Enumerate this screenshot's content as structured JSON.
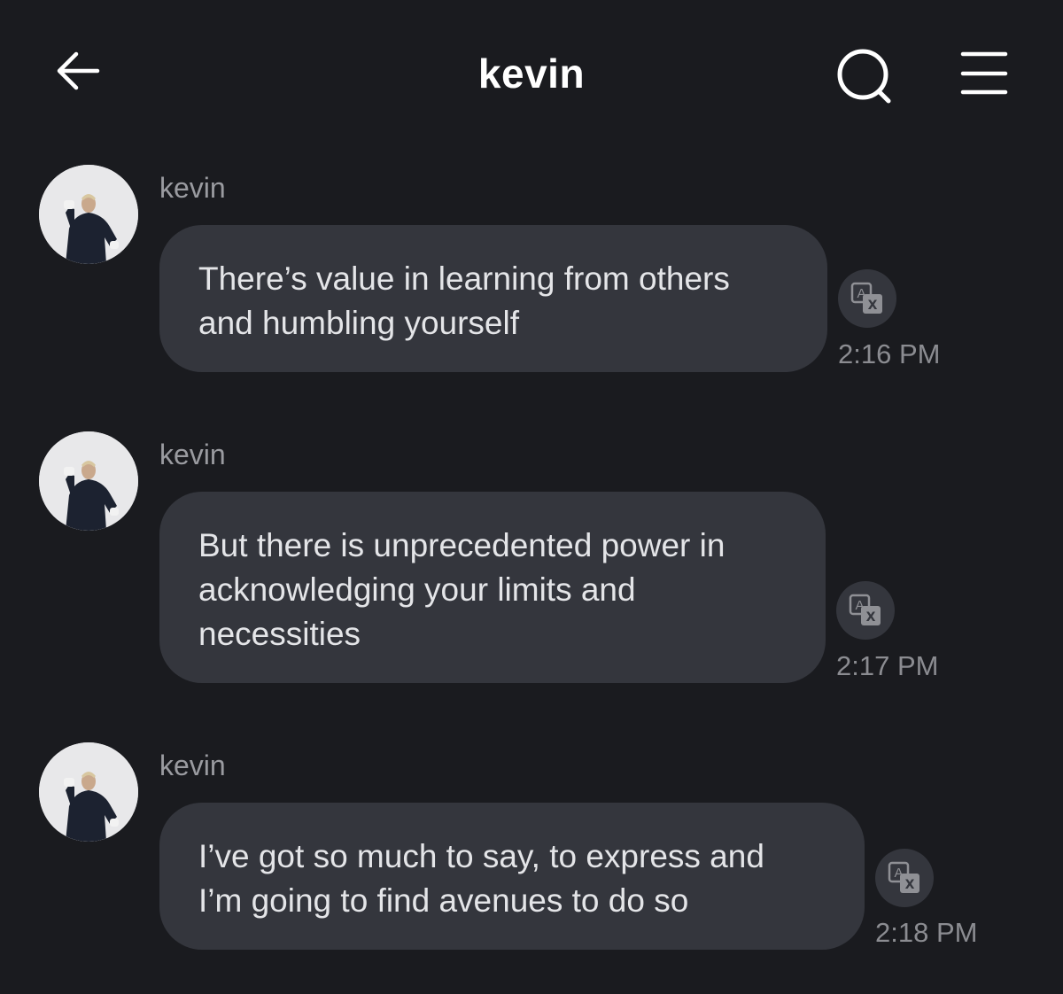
{
  "header": {
    "title": "kevin"
  },
  "icons": {
    "back": "back-arrow-icon",
    "search": "search-icon",
    "menu": "menu-icon",
    "translate": "translate-icon"
  },
  "colors": {
    "background": "#1a1b1f",
    "bubble": "#34363d",
    "text": "#e4e5e8",
    "secondary_text": "#8b8c91"
  },
  "messages": [
    {
      "sender": "kevin",
      "lines": [
        "There’s value in learning from others",
        "and humbling yourself"
      ],
      "time": "2:16 PM"
    },
    {
      "sender": "kevin",
      "lines": [
        "But there is unprecedented power in",
        "acknowledging your limits and",
        "necessities"
      ],
      "time": "2:17 PM"
    },
    {
      "sender": "kevin",
      "lines": [
        "I’ve got so much to say, to express and",
        "I’m going to find avenues to do so"
      ],
      "time": "2:18 PM"
    }
  ]
}
